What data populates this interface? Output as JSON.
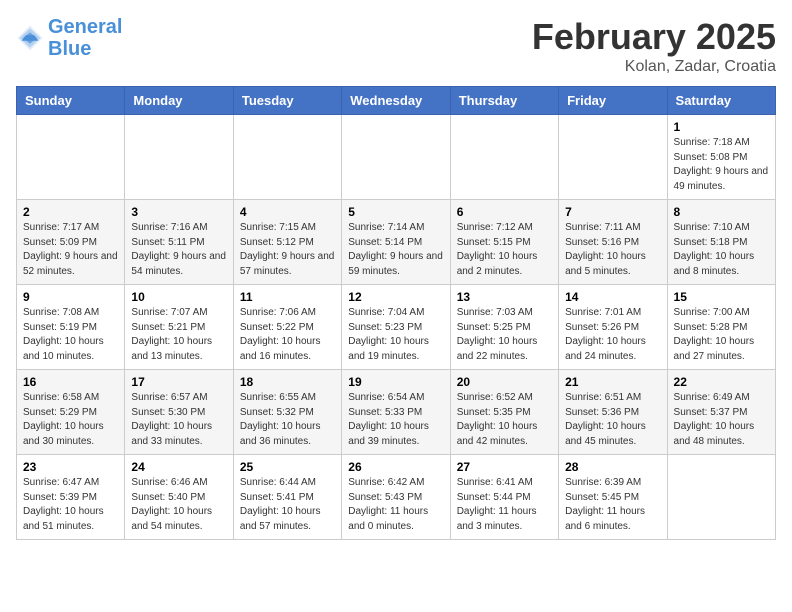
{
  "header": {
    "logo_line1": "General",
    "logo_line2": "Blue",
    "month": "February 2025",
    "location": "Kolan, Zadar, Croatia"
  },
  "days_of_week": [
    "Sunday",
    "Monday",
    "Tuesday",
    "Wednesday",
    "Thursday",
    "Friday",
    "Saturday"
  ],
  "weeks": [
    [
      {
        "day": "",
        "info": ""
      },
      {
        "day": "",
        "info": ""
      },
      {
        "day": "",
        "info": ""
      },
      {
        "day": "",
        "info": ""
      },
      {
        "day": "",
        "info": ""
      },
      {
        "day": "",
        "info": ""
      },
      {
        "day": "1",
        "info": "Sunrise: 7:18 AM\nSunset: 5:08 PM\nDaylight: 9 hours and 49 minutes."
      }
    ],
    [
      {
        "day": "2",
        "info": "Sunrise: 7:17 AM\nSunset: 5:09 PM\nDaylight: 9 hours and 52 minutes."
      },
      {
        "day": "3",
        "info": "Sunrise: 7:16 AM\nSunset: 5:11 PM\nDaylight: 9 hours and 54 minutes."
      },
      {
        "day": "4",
        "info": "Sunrise: 7:15 AM\nSunset: 5:12 PM\nDaylight: 9 hours and 57 minutes."
      },
      {
        "day": "5",
        "info": "Sunrise: 7:14 AM\nSunset: 5:14 PM\nDaylight: 9 hours and 59 minutes."
      },
      {
        "day": "6",
        "info": "Sunrise: 7:12 AM\nSunset: 5:15 PM\nDaylight: 10 hours and 2 minutes."
      },
      {
        "day": "7",
        "info": "Sunrise: 7:11 AM\nSunset: 5:16 PM\nDaylight: 10 hours and 5 minutes."
      },
      {
        "day": "8",
        "info": "Sunrise: 7:10 AM\nSunset: 5:18 PM\nDaylight: 10 hours and 8 minutes."
      }
    ],
    [
      {
        "day": "9",
        "info": "Sunrise: 7:08 AM\nSunset: 5:19 PM\nDaylight: 10 hours and 10 minutes."
      },
      {
        "day": "10",
        "info": "Sunrise: 7:07 AM\nSunset: 5:21 PM\nDaylight: 10 hours and 13 minutes."
      },
      {
        "day": "11",
        "info": "Sunrise: 7:06 AM\nSunset: 5:22 PM\nDaylight: 10 hours and 16 minutes."
      },
      {
        "day": "12",
        "info": "Sunrise: 7:04 AM\nSunset: 5:23 PM\nDaylight: 10 hours and 19 minutes."
      },
      {
        "day": "13",
        "info": "Sunrise: 7:03 AM\nSunset: 5:25 PM\nDaylight: 10 hours and 22 minutes."
      },
      {
        "day": "14",
        "info": "Sunrise: 7:01 AM\nSunset: 5:26 PM\nDaylight: 10 hours and 24 minutes."
      },
      {
        "day": "15",
        "info": "Sunrise: 7:00 AM\nSunset: 5:28 PM\nDaylight: 10 hours and 27 minutes."
      }
    ],
    [
      {
        "day": "16",
        "info": "Sunrise: 6:58 AM\nSunset: 5:29 PM\nDaylight: 10 hours and 30 minutes."
      },
      {
        "day": "17",
        "info": "Sunrise: 6:57 AM\nSunset: 5:30 PM\nDaylight: 10 hours and 33 minutes."
      },
      {
        "day": "18",
        "info": "Sunrise: 6:55 AM\nSunset: 5:32 PM\nDaylight: 10 hours and 36 minutes."
      },
      {
        "day": "19",
        "info": "Sunrise: 6:54 AM\nSunset: 5:33 PM\nDaylight: 10 hours and 39 minutes."
      },
      {
        "day": "20",
        "info": "Sunrise: 6:52 AM\nSunset: 5:35 PM\nDaylight: 10 hours and 42 minutes."
      },
      {
        "day": "21",
        "info": "Sunrise: 6:51 AM\nSunset: 5:36 PM\nDaylight: 10 hours and 45 minutes."
      },
      {
        "day": "22",
        "info": "Sunrise: 6:49 AM\nSunset: 5:37 PM\nDaylight: 10 hours and 48 minutes."
      }
    ],
    [
      {
        "day": "23",
        "info": "Sunrise: 6:47 AM\nSunset: 5:39 PM\nDaylight: 10 hours and 51 minutes."
      },
      {
        "day": "24",
        "info": "Sunrise: 6:46 AM\nSunset: 5:40 PM\nDaylight: 10 hours and 54 minutes."
      },
      {
        "day": "25",
        "info": "Sunrise: 6:44 AM\nSunset: 5:41 PM\nDaylight: 10 hours and 57 minutes."
      },
      {
        "day": "26",
        "info": "Sunrise: 6:42 AM\nSunset: 5:43 PM\nDaylight: 11 hours and 0 minutes."
      },
      {
        "day": "27",
        "info": "Sunrise: 6:41 AM\nSunset: 5:44 PM\nDaylight: 11 hours and 3 minutes."
      },
      {
        "day": "28",
        "info": "Sunrise: 6:39 AM\nSunset: 5:45 PM\nDaylight: 11 hours and 6 minutes."
      },
      {
        "day": "",
        "info": ""
      }
    ]
  ]
}
